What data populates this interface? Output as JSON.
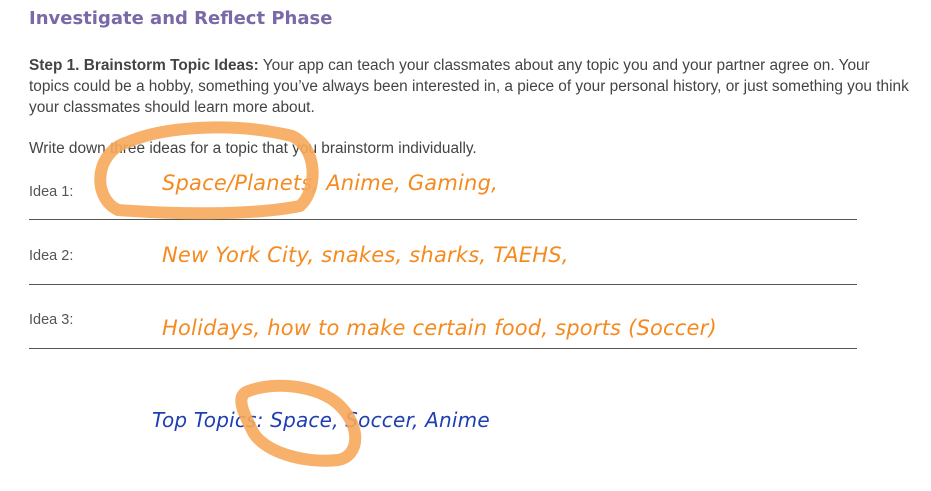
{
  "heading": "Investigate and Reflect Phase",
  "step": {
    "label": "Step 1. Brainstorm Topic Ideas:",
    "text": " Your app can teach your classmates about any topic you and your partner agree on. Your topics could be a hobby, something you’ve always been interested in, a piece of your personal history, or just something you think your classmates should learn more about."
  },
  "prompt": "Write down three ideas for a topic that you brainstorm individually.",
  "ideas": [
    {
      "label": "Idea 1:",
      "answer": "Space/Planets, Anime, Gaming,"
    },
    {
      "label": "Idea 2:",
      "answer": "New York City, snakes, sharks, TAEHS,"
    },
    {
      "label": "Idea 3:",
      "answer": "Holidays, how to make certain food, sports (Soccer)"
    }
  ],
  "top_topics": "Top Topics: Space, Soccer, Anime",
  "colors": {
    "heading": "#7b68a6",
    "handwriting_orange": "#f58a1f",
    "handwriting_blue": "#1f3fb0",
    "highlight_circle": "#f6a85a"
  }
}
